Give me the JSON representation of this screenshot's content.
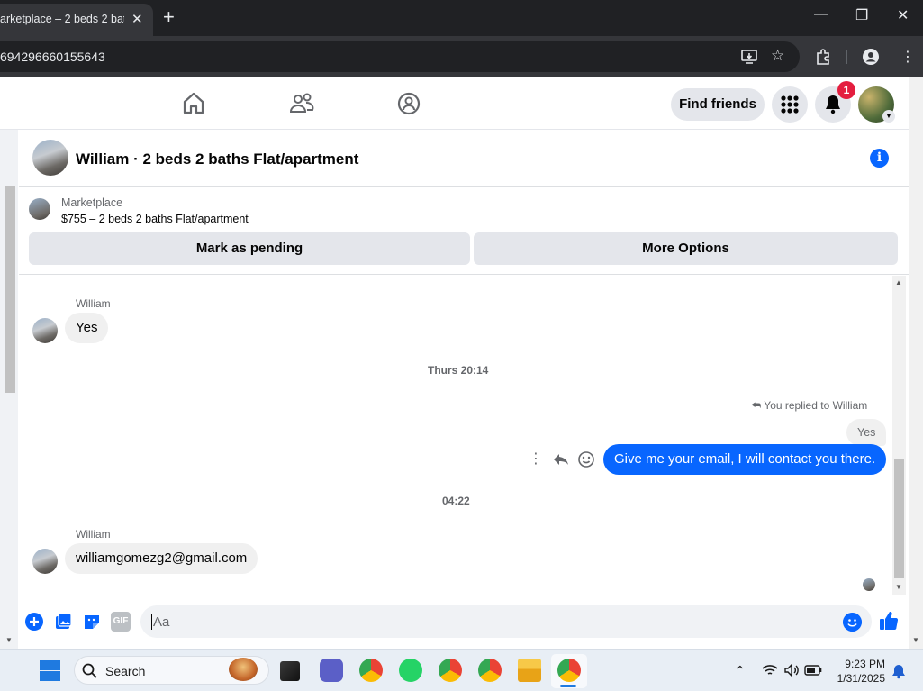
{
  "browser": {
    "tab_title": "arketplace – 2 beds 2 bath",
    "tab_close": "✕",
    "new_tab": "+",
    "url": "694296660155643"
  },
  "fb_header": {
    "find_friends": "Find friends",
    "notification_count": "1"
  },
  "chat": {
    "title": "William · 2 beds 2 baths Flat/apartment",
    "marketplace_label": "Marketplace",
    "listing": "$755 – 2 beds 2 baths Flat/apartment",
    "mark_pending": "Mark as pending",
    "more_options": "More Options"
  },
  "messages": {
    "sender1": "William",
    "msg1": "Yes",
    "time1": "Thurs 20:14",
    "replied_to": "You replied to William",
    "reply_quote": "Yes",
    "outgoing": "Give me your email, I will contact you there.",
    "time2": "04:22",
    "sender2": "William",
    "msg2": "williamgomezg2@gmail.com"
  },
  "composer": {
    "placeholder": "Aa",
    "gif": "GIF"
  },
  "taskbar": {
    "search": "Search",
    "time": "9:23 PM",
    "date": "1/31/2025"
  },
  "colors": {
    "accent": "#0866ff",
    "badge": "#e41e3f"
  }
}
